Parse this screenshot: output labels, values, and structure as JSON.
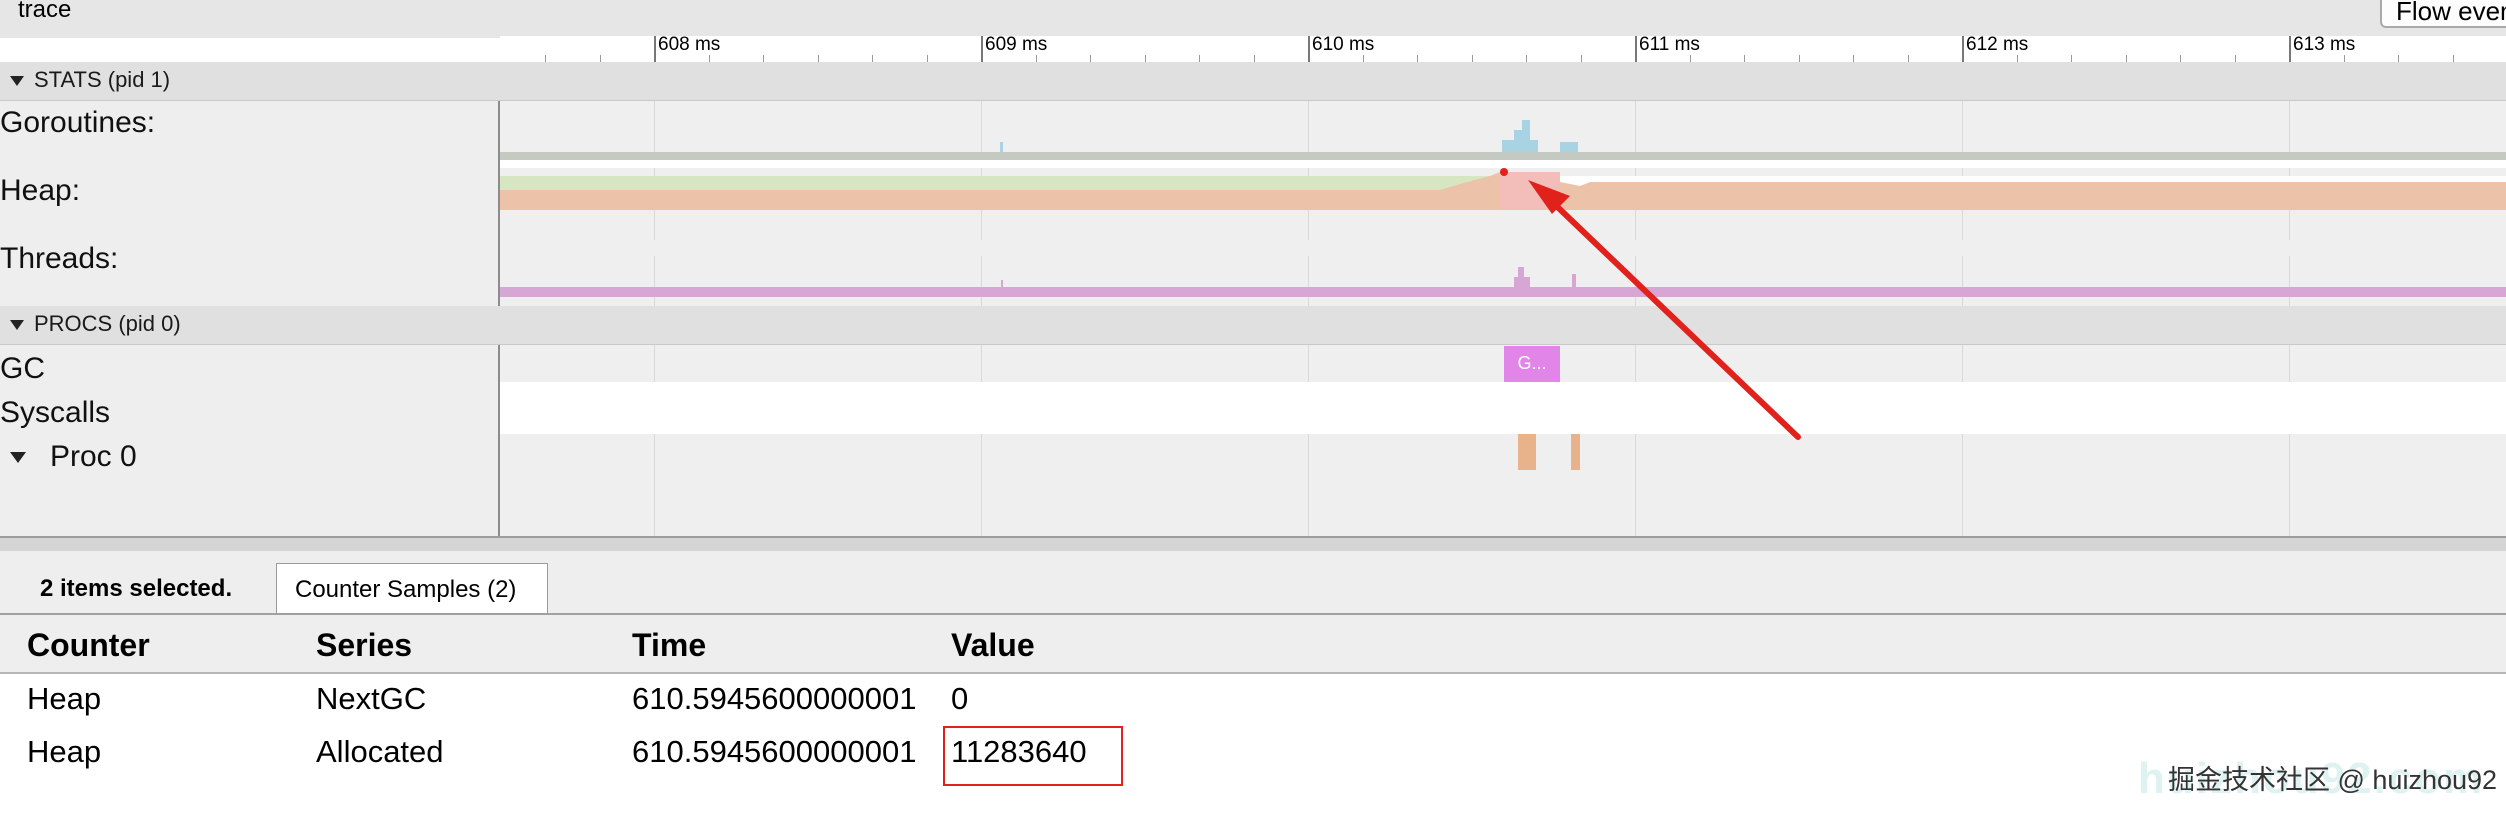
{
  "window": {
    "tab_label": "trace",
    "flow_button": "Flow events"
  },
  "ruler": {
    "ticks": [
      "608 ms",
      "609 ms",
      "610 ms",
      "611 ms",
      "612 ms",
      "613 ms"
    ]
  },
  "groups": {
    "stats": {
      "label": "STATS (pid 1)",
      "tracks": [
        "Goroutines:",
        "Heap:",
        "Threads:"
      ]
    },
    "procs": {
      "label": "PROCS (pid 0)",
      "tracks": [
        "GC",
        "Syscalls",
        "Proc 0"
      ]
    }
  },
  "timeline": {
    "gc_slice_label": "G..."
  },
  "colors": {
    "goroutines": "#a8d3e3",
    "heap_nextgc": "#d6e6c2",
    "heap_alloc": "#ecc2a9",
    "threads": "#d6a6d4",
    "gc_slice": "#e285e8",
    "proc_slice": "#e8b28a",
    "annotation": "#e0211c"
  },
  "bottom_panel": {
    "selection_text": "2 items selected.",
    "tab_label": "Counter Samples (2)",
    "columns": [
      "Counter",
      "Series",
      "Time",
      "Value"
    ],
    "rows": [
      {
        "counter": "Heap",
        "series": "NextGC",
        "time": "610.5945600000001",
        "value": "0"
      },
      {
        "counter": "Heap",
        "series": "Allocated",
        "time": "610.5945600000001",
        "value": "11283640"
      }
    ]
  },
  "watermark": "掘金技术社区 @ huizhou92"
}
